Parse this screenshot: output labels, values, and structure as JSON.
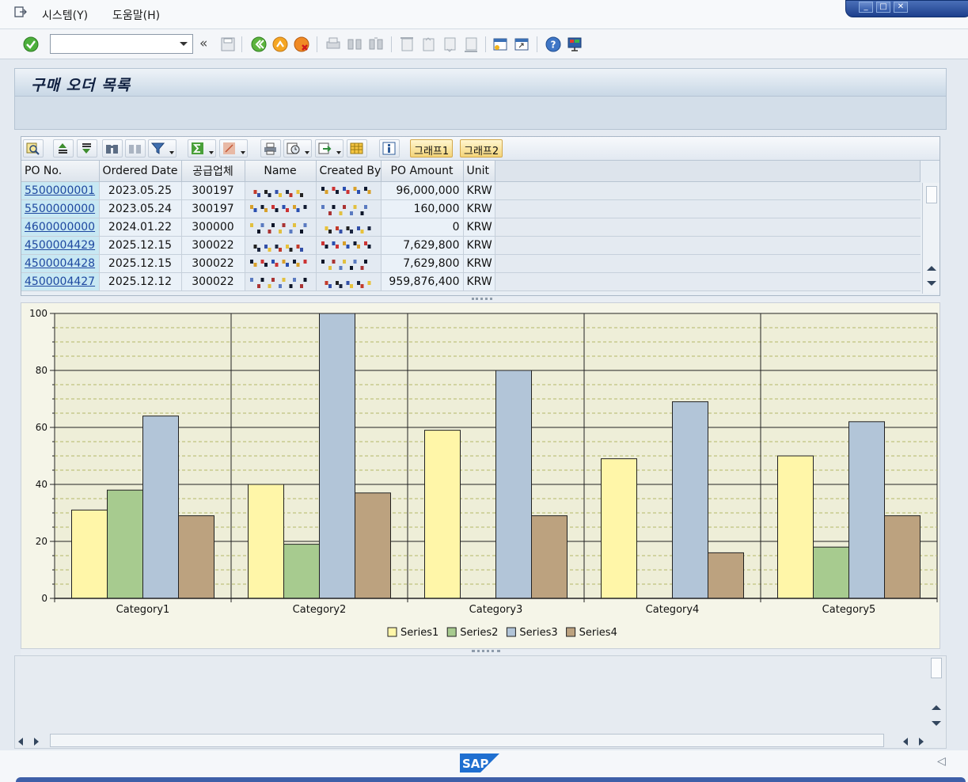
{
  "menu": {
    "items": [
      "시스템(Y)",
      "도움말(H)"
    ]
  },
  "toolbar": {
    "command_value": "",
    "back_chevrons": "«"
  },
  "title": "구매 오더 목록",
  "alv_toolbar": {
    "graph1_label": "그래프1",
    "graph2_label": "그래프2"
  },
  "grid": {
    "headers": [
      "PO No.",
      "Ordered Date",
      "공급업체",
      "Name",
      "Created By",
      "PO Amount",
      "Unit"
    ],
    "rows": [
      {
        "po": "5500000001",
        "date": "2023.05.25",
        "vendor": "300197",
        "amount": "96,000,000",
        "unit": "KRW"
      },
      {
        "po": "5500000000",
        "date": "2023.05.24",
        "vendor": "300197",
        "amount": "160,000",
        "unit": "KRW"
      },
      {
        "po": "4600000000",
        "date": "2024.01.22",
        "vendor": "300000",
        "amount": "0",
        "unit": "KRW"
      },
      {
        "po": "4500004429",
        "date": "2025.12.15",
        "vendor": "300022",
        "amount": "7,629,800",
        "unit": "KRW"
      },
      {
        "po": "4500004428",
        "date": "2025.12.15",
        "vendor": "300022",
        "amount": "7,629,800",
        "unit": "KRW"
      },
      {
        "po": "4500004427",
        "date": "2025.12.12",
        "vendor": "300022",
        "amount": "959,876,400",
        "unit": "KRW"
      }
    ]
  },
  "chart_data": {
    "type": "bar",
    "categories": [
      "Category1",
      "Category2",
      "Category3",
      "Category4",
      "Category5"
    ],
    "series": [
      {
        "name": "Series1",
        "color": "#fff6a8",
        "values": [
          31,
          40,
          59,
          49,
          50
        ]
      },
      {
        "name": "Series2",
        "color": "#a7cb8f",
        "values": [
          38,
          19,
          0,
          0,
          18
        ]
      },
      {
        "name": "Series3",
        "color": "#b2c5d8",
        "values": [
          64,
          100,
          80,
          69,
          62
        ]
      },
      {
        "name": "Series4",
        "color": "#bca27f",
        "values": [
          29,
          37,
          29,
          16,
          29
        ]
      }
    ],
    "ylim": [
      0,
      100
    ],
    "yticks": [
      0,
      20,
      40,
      60,
      80,
      100
    ],
    "grid": true,
    "legend_position": "bottom",
    "plot_background": "#eeeed8"
  },
  "footer": {
    "logo_text": "SAP"
  }
}
